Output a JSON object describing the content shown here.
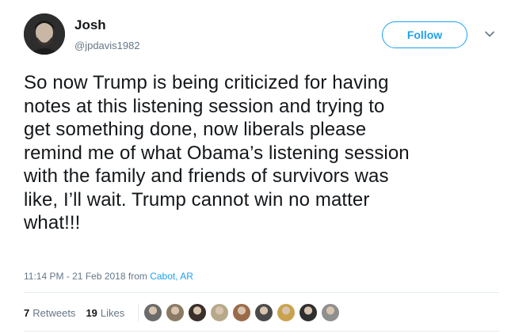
{
  "tweet": {
    "display_name": "Josh",
    "handle": "@jpdavis1982",
    "follow_label": "Follow",
    "text_lines": [
      "So now Trump is being criticized for having",
      "notes at this listening session and trying to",
      "get something done, now liberals please",
      "remind me of what Obama’s listening session",
      "with the family and friends of survivors was",
      "like, I’ll wait. Trump cannot win no matter",
      "what!!!"
    ],
    "timestamp": "11:14 PM - 21 Feb 2018",
    "from_word": "from",
    "location": "Cabot, AR",
    "retweets_count": "7",
    "retweets_label": "Retweets",
    "likes_count": "19",
    "likes_label": "Likes"
  },
  "icons": {
    "caret": "chevron-down-icon",
    "avatar": "avatar"
  },
  "colors": {
    "brand": "#1da1f2",
    "text": "#14171a",
    "muted": "#657786",
    "divider": "#e6ecf0"
  },
  "likers": [
    {
      "color": "#6b6b6b"
    },
    {
      "color": "#8a7a64"
    },
    {
      "color": "#3a2f2a"
    },
    {
      "color": "#b5a98a"
    },
    {
      "color": "#9a6b4a"
    },
    {
      "color": "#4a4a4a"
    },
    {
      "color": "#c9a24d"
    },
    {
      "color": "#2f2f2f"
    },
    {
      "color": "#8f8f8f"
    }
  ]
}
